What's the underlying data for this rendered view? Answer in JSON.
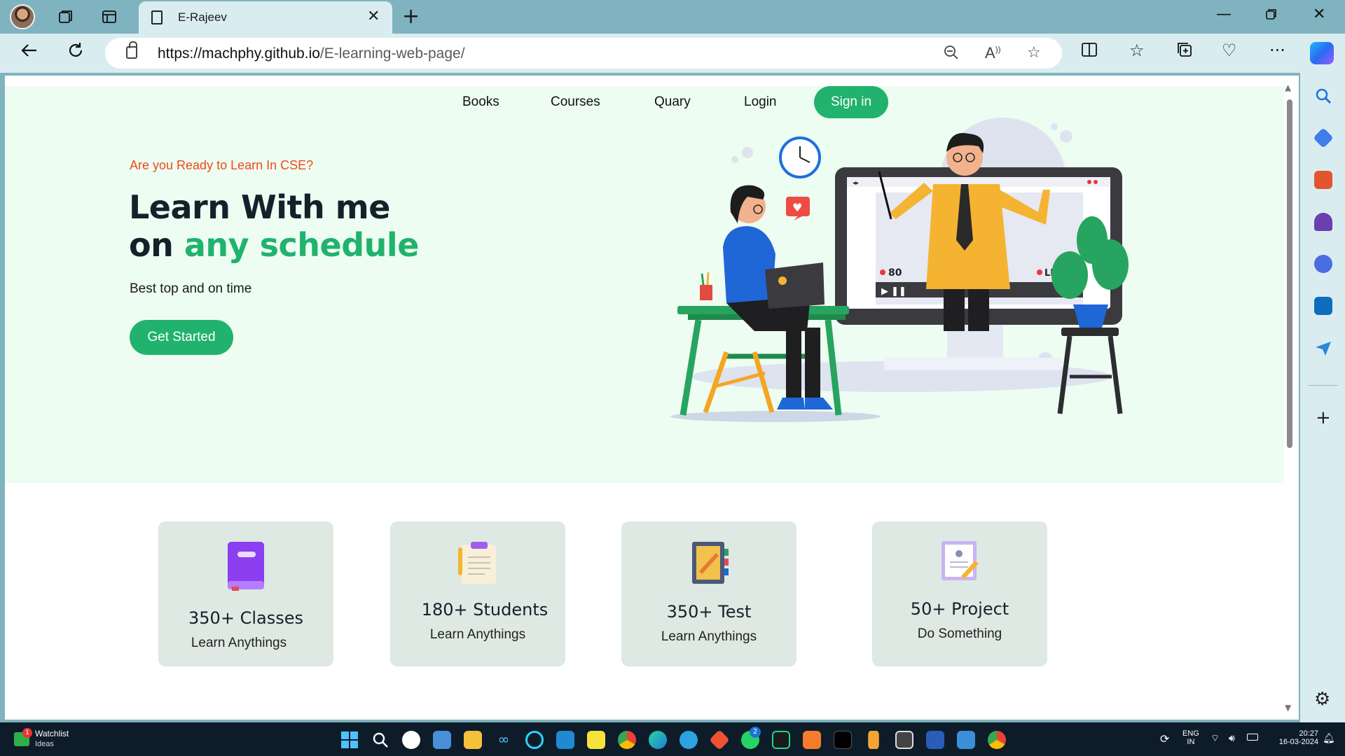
{
  "browser": {
    "tab_title": "E-Rajeev",
    "url_host": "https://machphy.github.io",
    "url_path": "/E-learning-web-page/"
  },
  "nav": {
    "links": [
      "Books",
      "Courses",
      "Quary",
      "Login"
    ],
    "signin_label": "Sign in"
  },
  "hero": {
    "tagline": "Are you Ready to Learn In CSE?",
    "headline_line1": "Learn With me",
    "headline_line2_prefix": "on ",
    "headline_line2_accent": "any schedule",
    "subtext": "Best top and on time",
    "cta_label": "Get Started",
    "illustration": {
      "viewer_count": "80",
      "live_label": "LIVE"
    }
  },
  "stats": [
    {
      "value": "350+ Classes",
      "caption": "Learn Anythings",
      "icon": "book-icon"
    },
    {
      "value": "180+ Students",
      "caption": "Learn Anythings",
      "icon": "clipboard-icon"
    },
    {
      "value": "350+ Test",
      "caption": "Learn Anythings",
      "icon": "notebook-icon"
    },
    {
      "value": "50+ Project",
      "caption": "Do Something",
      "icon": "certificate-icon"
    }
  ],
  "taskbar": {
    "widget_title": "Watchlist",
    "widget_sub": "Ideas",
    "widget_badge": "1",
    "whatsapp_badge": "2",
    "lang_top": "ENG",
    "lang_bottom": "IN",
    "time": "20:27",
    "date": "16-03-2024"
  },
  "colors": {
    "accent": "#21b26d",
    "tagline": "#ef4a1b",
    "hero_bg": "#edfdf1",
    "card_bg": "#dde9e2"
  }
}
